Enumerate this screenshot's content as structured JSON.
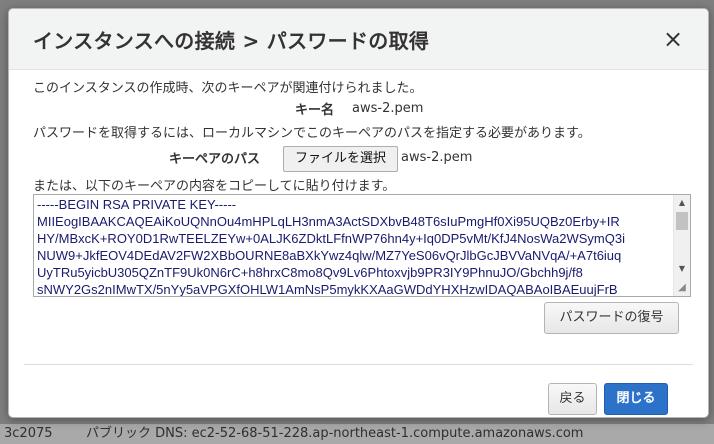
{
  "background": {
    "instance_id_fragment": "3c2075",
    "public_dns": "パブリック DNS: ec2-52-68-51-228.ap-northeast-1.compute.amazonaws.com"
  },
  "dialog": {
    "title": "インスタンスへの接続 > パスワードの取得",
    "close_symbol": "×",
    "intro_text": "このインスタンスの作成時、次のキーペアが関連付けられました。",
    "key_name_label": "キー名",
    "key_name_value": "aws-2.pem",
    "instruction_text": "パスワードを取得するには、ローカルマシンでこのキーペアのパスを指定する必要があります。",
    "key_pair_path_label": "キーペアのパス",
    "choose_file_label": "ファイルを選択",
    "chosen_file_name": "aws-2.pem",
    "or_paste_text": "または、以下のキーペアの内容をコピーしてに貼り付けます。",
    "key_content": "-----BEGIN RSA PRIVATE KEY-----\nMIIEogIBAAKCAQEAiKoUQNnOu4mHPLqLH3nmA3ActSDXbvB48T6sIuPmgHf0Xi95UQBz0Erby+IR\nHY/MBxcK+ROY0D1RwTEELZEYw+0ALJK6ZDktLFfnWP76hn4y+Iq0DP5vMt/KfJ4NosWa2WSymQ3i\nNUW9+JkfEOV4DEdAV2FW2XBbOURNE8aBXkYwz4qlw/MZ7YeS06vQrJlbGcJBVVaNVqA/+A7t6iuq\nUyTRu5yicbU305QZnTF9Uk0N6rC+h8hrxC8mo8Qv9Lv6Phtoxvjb9PR3IY9PhnuJO/Gbchh9j/f8\nsNWY2Gs2nIMwTX/5nYy5aVPGXfOHLW1AmNsP5mykKXAaGWDdYHXHzwIDAQABAoIBAEuujFrB",
    "decrypt_button": "パスワードの復号",
    "back_button": "戻る",
    "close_button": "閉じる"
  },
  "colors": {
    "primary": "#2c72c9",
    "header_bg": "#f2f3f3",
    "overlay": "#7f7f7f"
  }
}
